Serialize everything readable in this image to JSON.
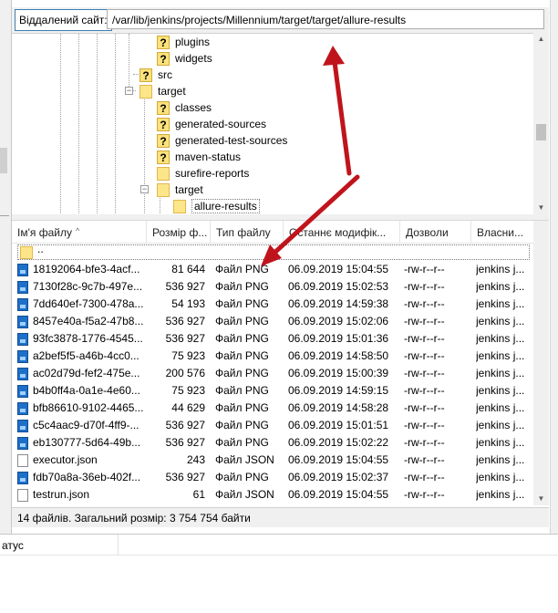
{
  "remote_site": {
    "label": "Віддалений сайт:",
    "path": "/var/lib/jenkins/projects/Millennium/target/target/allure-results"
  },
  "tree": [
    {
      "label": "plugins",
      "icon": "unknown-folder-icon"
    },
    {
      "label": "widgets",
      "icon": "unknown-folder-icon"
    },
    {
      "label": "src",
      "icon": "unknown-folder-icon"
    },
    {
      "label": "target",
      "icon": "folder-icon",
      "expanded": true
    },
    {
      "label": "classes",
      "icon": "unknown-folder-icon"
    },
    {
      "label": "generated-sources",
      "icon": "unknown-folder-icon"
    },
    {
      "label": "generated-test-sources",
      "icon": "unknown-folder-icon"
    },
    {
      "label": "maven-status",
      "icon": "unknown-folder-icon"
    },
    {
      "label": "surefire-reports",
      "icon": "folder-icon"
    },
    {
      "label": "target",
      "icon": "folder-icon",
      "expanded": true
    },
    {
      "label": "allure-results",
      "icon": "folder-icon",
      "selected": true
    }
  ],
  "list_headers": {
    "name": "Ім'я файлу",
    "size": "Розмір ф...",
    "type": "Тип файлу",
    "modified": "Останнє модифік...",
    "permissions": "Дозволи",
    "owner": "Власни..."
  },
  "parent_dir": "..",
  "files": [
    {
      "name": "18192064-bfe3-4acf...",
      "size": "81 644",
      "type": "Файл PNG",
      "date": "06.09.2019 15:04:55",
      "perm": "-rw-r--r--",
      "owner": "jenkins j...",
      "icon": "png-file-icon"
    },
    {
      "name": "7130f28c-9c7b-497e...",
      "size": "536 927",
      "type": "Файл PNG",
      "date": "06.09.2019 15:02:53",
      "perm": "-rw-r--r--",
      "owner": "jenkins j...",
      "icon": "png-file-icon"
    },
    {
      "name": "7dd640ef-7300-478a...",
      "size": "54 193",
      "type": "Файл PNG",
      "date": "06.09.2019 14:59:38",
      "perm": "-rw-r--r--",
      "owner": "jenkins j...",
      "icon": "png-file-icon"
    },
    {
      "name": "8457e40a-f5a2-47b8...",
      "size": "536 927",
      "type": "Файл PNG",
      "date": "06.09.2019 15:02:06",
      "perm": "-rw-r--r--",
      "owner": "jenkins j...",
      "icon": "png-file-icon"
    },
    {
      "name": "93fc3878-1776-4545...",
      "size": "536 927",
      "type": "Файл PNG",
      "date": "06.09.2019 15:01:36",
      "perm": "-rw-r--r--",
      "owner": "jenkins j...",
      "icon": "png-file-icon"
    },
    {
      "name": "a2bef5f5-a46b-4cc0...",
      "size": "75 923",
      "type": "Файл PNG",
      "date": "06.09.2019 14:58:50",
      "perm": "-rw-r--r--",
      "owner": "jenkins j...",
      "icon": "png-file-icon"
    },
    {
      "name": "ac02d79d-fef2-475e...",
      "size": "200 576",
      "type": "Файл PNG",
      "date": "06.09.2019 15:00:39",
      "perm": "-rw-r--r--",
      "owner": "jenkins j...",
      "icon": "png-file-icon"
    },
    {
      "name": "b4b0ff4a-0a1e-4e60...",
      "size": "75 923",
      "type": "Файл PNG",
      "date": "06.09.2019 14:59:15",
      "perm": "-rw-r--r--",
      "owner": "jenkins j...",
      "icon": "png-file-icon"
    },
    {
      "name": "bfb86610-9102-4465...",
      "size": "44 629",
      "type": "Файл PNG",
      "date": "06.09.2019 14:58:28",
      "perm": "-rw-r--r--",
      "owner": "jenkins j...",
      "icon": "png-file-icon"
    },
    {
      "name": "c5c4aac9-d70f-4ff9-...",
      "size": "536 927",
      "type": "Файл PNG",
      "date": "06.09.2019 15:01:51",
      "perm": "-rw-r--r--",
      "owner": "jenkins j...",
      "icon": "png-file-icon"
    },
    {
      "name": "eb130777-5d64-49b...",
      "size": "536 927",
      "type": "Файл PNG",
      "date": "06.09.2019 15:02:22",
      "perm": "-rw-r--r--",
      "owner": "jenkins j...",
      "icon": "png-file-icon"
    },
    {
      "name": "executor.json",
      "size": "243",
      "type": "Файл JSON",
      "date": "06.09.2019 15:04:55",
      "perm": "-rw-r--r--",
      "owner": "jenkins j...",
      "icon": "json-file-icon"
    },
    {
      "name": "fdb70a8a-36eb-402f...",
      "size": "536 927",
      "type": "Файл PNG",
      "date": "06.09.2019 15:02:37",
      "perm": "-rw-r--r--",
      "owner": "jenkins j...",
      "icon": "png-file-icon"
    },
    {
      "name": "testrun.json",
      "size": "61",
      "type": "Файл JSON",
      "date": "06.09.2019 15:04:55",
      "perm": "-rw-r--r--",
      "owner": "jenkins j...",
      "icon": "json-file-icon"
    }
  ],
  "status_line": "14 файлів. Загальний розмір: 3 754 754 байти",
  "queue": {
    "status_header": "атус"
  },
  "colors": {
    "annotation_arrow": "#c0141c",
    "label_border": "#3c7fb1"
  }
}
